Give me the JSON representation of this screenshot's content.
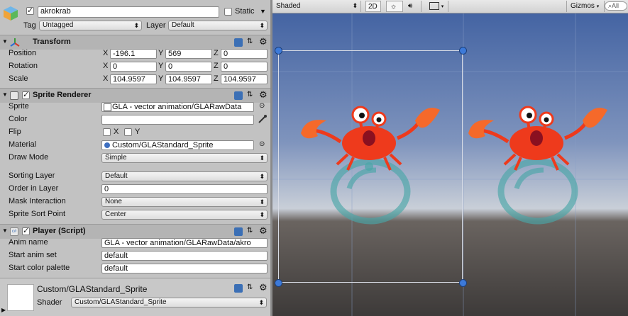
{
  "inspector": {
    "object_name": "akrokrab",
    "static_label": "Static",
    "tag_label": "Tag",
    "tag_value": "Untagged",
    "layer_label": "Layer",
    "layer_value": "Default",
    "transform": {
      "title": "Transform",
      "position": {
        "label": "Position",
        "x": "-196.1",
        "y": "569",
        "z": "0"
      },
      "rotation": {
        "label": "Rotation",
        "x": "0",
        "y": "0",
        "z": "0"
      },
      "scale": {
        "label": "Scale",
        "x": "104.9597",
        "y": "104.9597",
        "z": "104.9597"
      }
    },
    "sprite_renderer": {
      "title": "Sprite Renderer",
      "sprite_label": "Sprite",
      "sprite_value": "GLA - vector animation/GLARawData",
      "color_label": "Color",
      "flip_label": "Flip",
      "flip_x": "X",
      "flip_y": "Y",
      "material_label": "Material",
      "material_value": "Custom/GLAStandard_Sprite",
      "draw_mode_label": "Draw Mode",
      "draw_mode_value": "Simple",
      "sorting_layer_label": "Sorting Layer",
      "sorting_layer_value": "Default",
      "order_label": "Order in Layer",
      "order_value": "0",
      "mask_label": "Mask Interaction",
      "mask_value": "None",
      "sort_point_label": "Sprite Sort Point",
      "sort_point_value": "Center"
    },
    "player": {
      "title": "Player (Script)",
      "anim_name_label": "Anim name",
      "anim_name_value": "GLA - vector animation/GLARawData/akro",
      "start_anim_label": "Start anim set",
      "start_anim_value": "default",
      "start_color_label": "Start color palette",
      "start_color_value": "default"
    },
    "material": {
      "name": "Custom/GLAStandard_Sprite",
      "shader_label": "Shader",
      "shader_value": "Custom/GLAStandard_Sprite"
    },
    "axis": {
      "x": "X",
      "y": "Y",
      "z": "Z"
    }
  },
  "scene": {
    "shading_mode": "Shaded",
    "mode_2d": "2D",
    "gizmos_label": "Gizmos",
    "search_placeholder": "All"
  },
  "colors": {
    "crab_red": "#ee3a1c",
    "crab_orange": "#f5692a",
    "ring": "#4aa6a8",
    "sky_top": "#3e5fa0",
    "ground": "#4a4644",
    "handle": "#3d7ad9"
  }
}
